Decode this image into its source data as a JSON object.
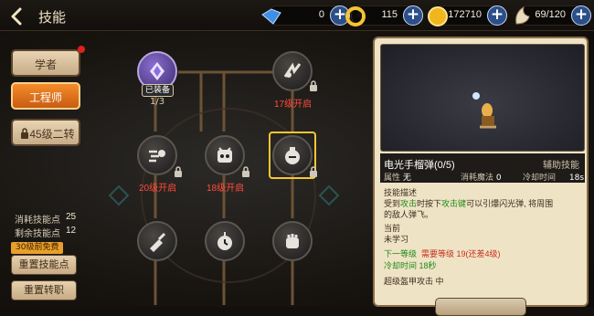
{
  "header": {
    "title": "技能"
  },
  "resources": [
    {
      "name": "blue-gem",
      "value": "0"
    },
    {
      "name": "gold-swirl",
      "value": "115"
    },
    {
      "name": "gold-coin",
      "value": "172710"
    },
    {
      "name": "stamina",
      "value": "69/120"
    }
  ],
  "tabs": [
    {
      "label": "学者"
    },
    {
      "label": "工程师"
    },
    {
      "label": "45级二转"
    }
  ],
  "points": {
    "consumed_label": "消耗技能点",
    "consumed_value": "25",
    "remaining_label": "剩余技能点",
    "remaining_value": "12"
  },
  "free_badge": "30级前免费",
  "reset_points": "重置技能点",
  "reset_class": "重置转职",
  "tree": {
    "equipped": "已装备",
    "equipped_level": "1/3",
    "unlock_17": "17级开启",
    "unlock_20": "20级开启",
    "unlock_18": "18级开启"
  },
  "skill": {
    "name": "电光手榴弹(0/5)",
    "type": "辅助技能",
    "attr_label": "属性",
    "attr_value": "无",
    "mana_label": "消耗魔法",
    "mana_value": "0",
    "cd_label": "冷却时间",
    "cd_value": "18s",
    "desc_title": "技能描述",
    "desc_1": "受到",
    "desc_2": "攻击",
    "desc_3": "时按下",
    "desc_4": "攻击键",
    "desc_5": "可以引爆闪光弹, 将周围",
    "desc_6": "的敌人弹飞。",
    "current_label": "当前",
    "current_value": "未学习",
    "next_label": "下一等级",
    "next_req": "需要等级 19(还差4级)",
    "next_cd": "冷却时间 18秒",
    "armor": "超级盔甲攻击  中"
  },
  "colors": {
    "accent": "#f7c638",
    "locked": "#ff4b3a",
    "panel": "#efe3c6"
  }
}
